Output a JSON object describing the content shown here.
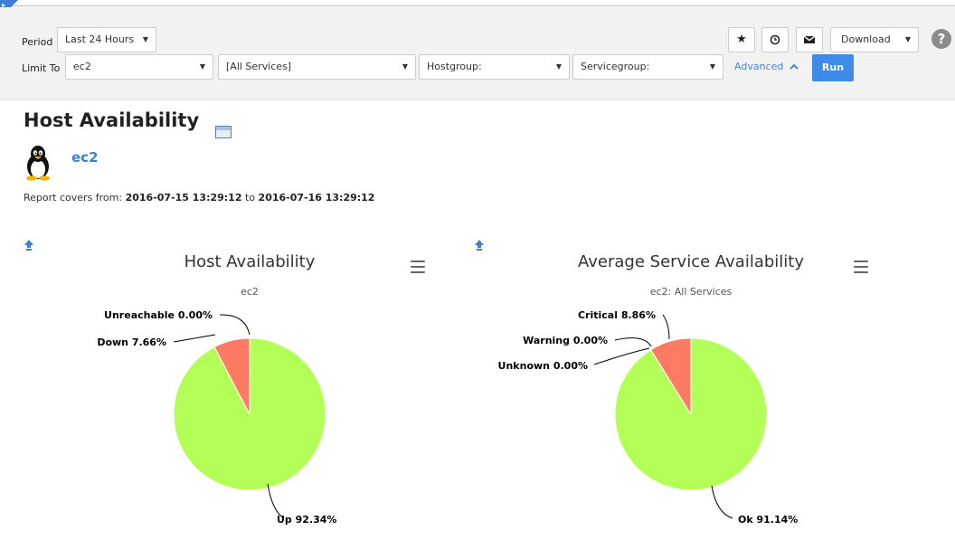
{
  "toolbar": {
    "period_label": "Period",
    "period_value": "Last 24 Hours",
    "limit_label": "Limit To",
    "host_value": "ec2",
    "services_value": "[All Services]",
    "hostgroup_value": "Hostgroup:",
    "servicegroup_value": "Servicegroup:",
    "advanced_label": "Advanced",
    "run_label": "Run",
    "download_label": "Download",
    "help_label": "?",
    "icons": [
      "star-icon",
      "clock-icon",
      "envelope-icon"
    ]
  },
  "page": {
    "title": "Host Availability",
    "host": "ec2",
    "covers_prefix": "Report covers from:",
    "covers_from": "2016-07-15 13:29:12",
    "covers_to_word": "to",
    "covers_to": "2016-07-16 13:29:12"
  },
  "chart_data": [
    {
      "type": "pie",
      "title": "Host Availability",
      "subtitle": "ec2",
      "slices": [
        {
          "label": "Up",
          "value": 92.34,
          "display": "Up 92.34%",
          "color": "#b3ff58"
        },
        {
          "label": "Down",
          "value": 7.66,
          "display": "Down 7.66%",
          "color": "#ff7a63"
        },
        {
          "label": "Unreachable",
          "value": 0.0,
          "display": "Unreachable 0.00%",
          "color": "#999999"
        }
      ]
    },
    {
      "type": "pie",
      "title": "Average Service Availability",
      "subtitle": "ec2: All Services",
      "slices": [
        {
          "label": "Ok",
          "value": 91.14,
          "display": "Ok 91.14%",
          "color": "#b3ff58"
        },
        {
          "label": "Critical",
          "value": 8.86,
          "display": "Critical 8.86%",
          "color": "#ff7a63"
        },
        {
          "label": "Warning",
          "value": 0.0,
          "display": "Warning 0.00%",
          "color": "#ffd24d"
        },
        {
          "label": "Unknown",
          "value": 0.0,
          "display": "Unknown 0.00%",
          "color": "#cccccc"
        }
      ]
    }
  ]
}
